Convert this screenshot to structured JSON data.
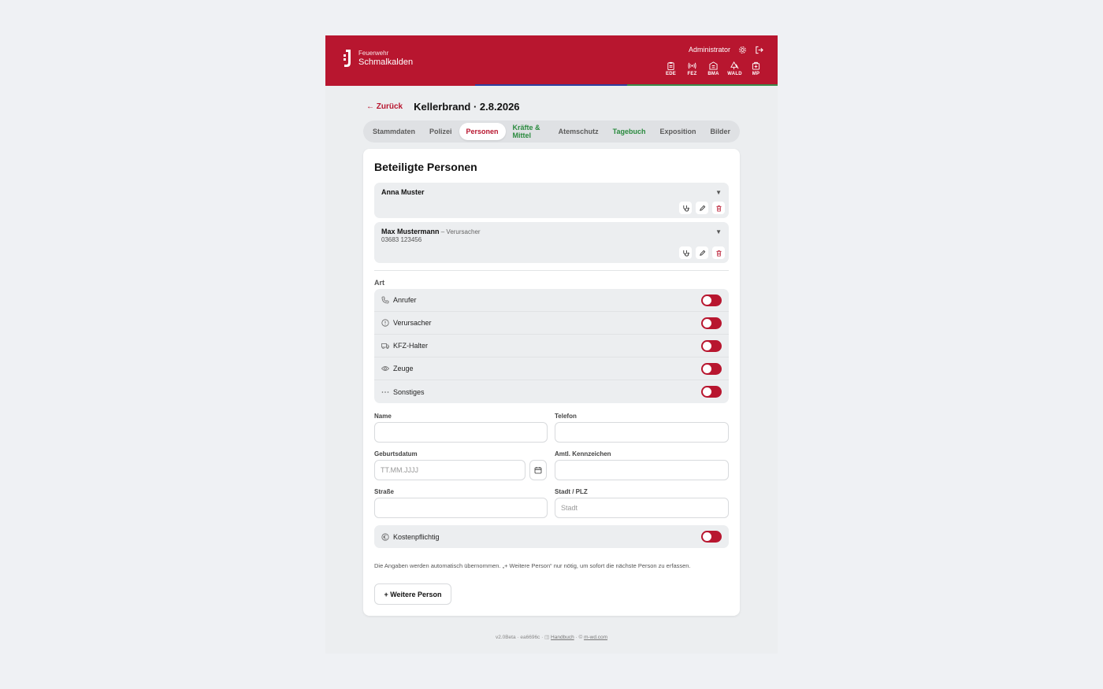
{
  "header": {
    "brand_line1": "Feuerwehr",
    "brand_line2": "Schmalkalden",
    "user": "Administrator",
    "modules": [
      {
        "label": "EDE",
        "icon": "clipboard-icon"
      },
      {
        "label": "FEZ",
        "icon": "radio-icon"
      },
      {
        "label": "BMA",
        "icon": "building-icon"
      },
      {
        "label": "WALD",
        "icon": "tree-icon"
      },
      {
        "label": "MP",
        "icon": "medkit-icon"
      }
    ],
    "colors": {
      "brand": "#b8162f",
      "stripe_blue": "#2e3f9e",
      "stripe_green": "#3a8a4a"
    }
  },
  "titlebar": {
    "back_label": "← Zurück",
    "title": "Kellerbrand · 2.8.2026"
  },
  "tabs": [
    {
      "label": "Stammdaten",
      "state": "normal"
    },
    {
      "label": "Polizei",
      "state": "normal"
    },
    {
      "label": "Personen",
      "state": "active"
    },
    {
      "label": "Kräfte & Mittel",
      "state": "green"
    },
    {
      "label": "Atemschutz",
      "state": "normal"
    },
    {
      "label": "Tagebuch",
      "state": "green"
    },
    {
      "label": "Exposition",
      "state": "normal"
    },
    {
      "label": "Bilder",
      "state": "normal"
    }
  ],
  "card": {
    "title": "Beteiligte Personen",
    "persons": [
      {
        "name": "Anna Muster",
        "role": "",
        "phone": ""
      },
      {
        "name": "Max Mustermann",
        "role": " – Verursacher",
        "phone": "03683 123456"
      }
    ],
    "art_label": "Art",
    "art_items": [
      {
        "label": "Anrufer",
        "icon": "phone-icon"
      },
      {
        "label": "Verursacher",
        "icon": "alert-circle-icon"
      },
      {
        "label": "KFZ-Halter",
        "icon": "truck-icon"
      },
      {
        "label": "Zeuge",
        "icon": "eye-icon"
      },
      {
        "label": "Sonstiges",
        "icon": "more-icon"
      }
    ],
    "fields": {
      "name_label": "Name",
      "telefon_label": "Telefon",
      "geburtsdatum_label": "Geburtsdatum",
      "geburtsdatum_placeholder": "TT.MM.JJJJ",
      "kennzeichen_label": "Amtl. Kennzeichen",
      "strasse_label": "Straße",
      "stadt_label": "Stadt / PLZ",
      "stadt_placeholder": "Stadt"
    },
    "kosten_label": "Kostenpflichtig",
    "hint": "Die Angaben werden automatisch übernommen. „+ Weitere Person“ nur nötig, um sofort die nächste Person zu erfassen.",
    "add_button": "+ Weitere Person"
  },
  "footer": {
    "version": "v2.0Beta · ea6696c · ",
    "handbuch": "Handbuch",
    "sep": " · © ",
    "site": "m-wd.com"
  }
}
